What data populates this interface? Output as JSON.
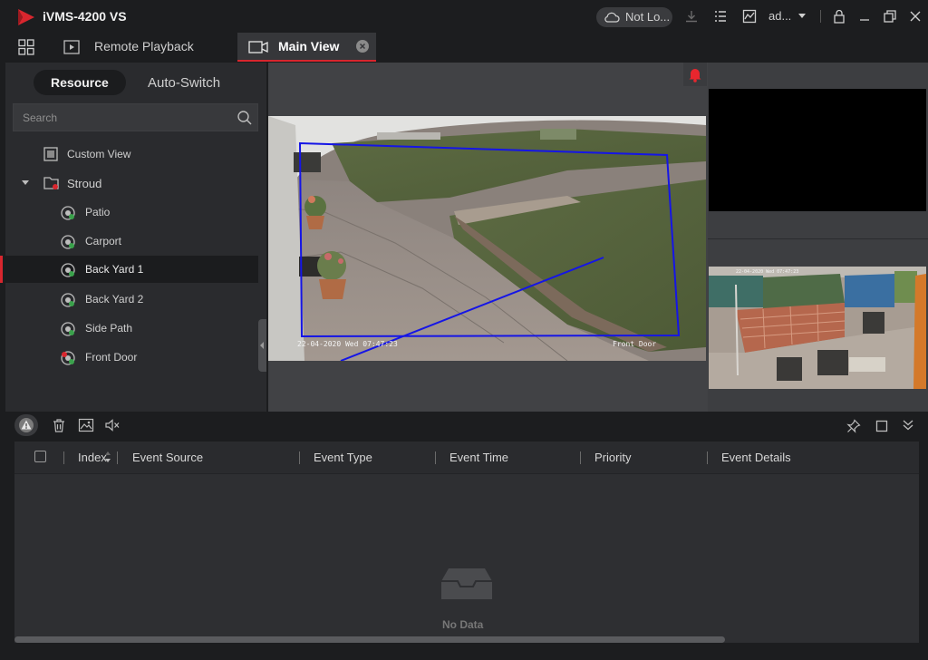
{
  "app": {
    "title": "iVMS-4200 VS",
    "brand_color": "#d8262e"
  },
  "titlebar": {
    "login_status": "Not Lo...",
    "user": "ad...",
    "icons": [
      "cloud-icon",
      "download-icon",
      "task-list-icon",
      "monitor-icon",
      "chevron-down-icon",
      "lock-icon",
      "minimize-icon",
      "restore-icon",
      "close-icon"
    ]
  },
  "tabs": {
    "remote_playback": "Remote Playback",
    "main_view": "Main View"
  },
  "left_panel": {
    "segment": {
      "resource": "Resource",
      "auto_switch": "Auto-Switch"
    },
    "search_placeholder": "Search",
    "tree": {
      "custom_view": "Custom View",
      "group": "Stroud",
      "cameras": [
        "Patio",
        "Carport",
        "Back Yard 1",
        "Back Yard 2",
        "Side Path",
        "Front Door"
      ],
      "selected": "Back Yard 1"
    }
  },
  "feeds": {
    "main": {
      "timestamp": "22-04-2020 Wed 07:47:23",
      "camera_name": "Front Door"
    }
  },
  "event_panel": {
    "columns": {
      "index": "Index",
      "event_source": "Event Source",
      "event_type": "Event Type",
      "event_time": "Event Time",
      "priority": "Priority",
      "event_details": "Event Details"
    },
    "empty_text": "No Data"
  }
}
